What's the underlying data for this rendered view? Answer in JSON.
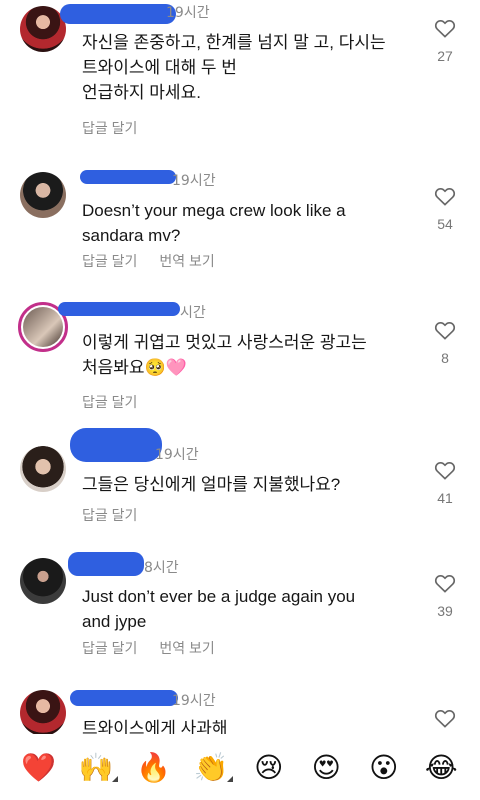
{
  "comments": [
    {
      "time": "19시간",
      "text": "자신을 존중하고, 한계를 넘지 말 고, 다시는\n트와이스에 대해 두 번\n언급하지 마세요.",
      "actions": [
        "답글 달기"
      ],
      "likes": "27"
    },
    {
      "time": "19시간",
      "text": "Doesn’t your mega crew look like a\nsandara mv?",
      "actions": [
        "답글 달기",
        "번역 보기"
      ],
      "likes": "54"
    },
    {
      "time": "시간",
      "text": "이렇게 귀엽고 멋있고 사랑스러운 광고는\n처음봐요🥺🩷",
      "actions": [
        "답글 달기"
      ],
      "likes": "8"
    },
    {
      "time": "19시간",
      "text": "그들은 당신에게 얼마를 지불했나요?",
      "actions": [
        "답글 달기"
      ],
      "likes": "41"
    },
    {
      "time": "8시간",
      "text": "Just don’t ever be a judge again you\nand jype",
      "actions": [
        "답글 달기",
        "번역 보기"
      ],
      "likes": "39"
    },
    {
      "time": "19시간",
      "text": "트와이스에게 사과해",
      "actions": [],
      "likes": ""
    }
  ],
  "emoji_bar": [
    "❤️",
    "🙌",
    "🔥",
    "👏",
    "😢",
    "😍",
    "😮",
    "😂"
  ],
  "colors": {
    "redaction": "#2f5fe0",
    "story_ring": "#c22f8a",
    "meta_text": "#8a8a8a"
  }
}
